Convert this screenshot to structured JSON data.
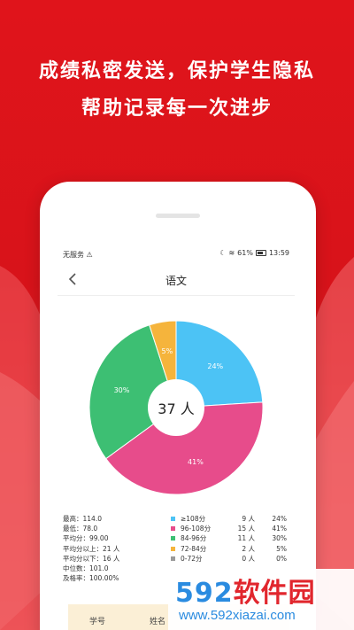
{
  "headline": {
    "line1": "成绩私密发送，保护学生隐私",
    "line2": "帮助记录每一次进步"
  },
  "status_bar": {
    "carrier": "无服务",
    "battery": "61%",
    "time": "13:59"
  },
  "nav": {
    "title": "语文"
  },
  "chart_data": {
    "type": "pie",
    "center_label": "37 人",
    "slices": [
      {
        "label": "≥108分",
        "value": 24,
        "color": "#4cc3f5",
        "text": "24%"
      },
      {
        "label": "96-108分",
        "value": 41,
        "color": "#e74c8b",
        "text": "41%"
      },
      {
        "label": "84-96分",
        "value": 30,
        "color": "#3dbf73",
        "text": "30%"
      },
      {
        "label": "72-84分",
        "value": 5,
        "color": "#f5b43c",
        "text": "5%"
      }
    ]
  },
  "stats": [
    "最高：114.0",
    "最低：78.0",
    "平均分：99.00",
    "平均分以上：21 人",
    "平均分以下：16 人",
    "中位数：101.0",
    "及格率：100.00%"
  ],
  "legend": [
    {
      "label": "≥108分",
      "count": "9 人",
      "pct": "24%",
      "color": "#4cc3f5"
    },
    {
      "label": "96-108分",
      "count": "15 人",
      "pct": "41%",
      "color": "#e74c8b"
    },
    {
      "label": "84-96分",
      "count": "11 人",
      "pct": "30%",
      "color": "#3dbf73"
    },
    {
      "label": "72-84分",
      "count": "2 人",
      "pct": "5%",
      "color": "#f5b43c"
    },
    {
      "label": "0-72分",
      "count": "0 人",
      "pct": "0%",
      "color": "#9a9a9a"
    }
  ],
  "table": {
    "headers": [
      "学号",
      "姓名"
    ]
  },
  "watermark": {
    "logo_num": "592",
    "logo_cn": "软件园",
    "url": "www.592xiazai.com"
  }
}
